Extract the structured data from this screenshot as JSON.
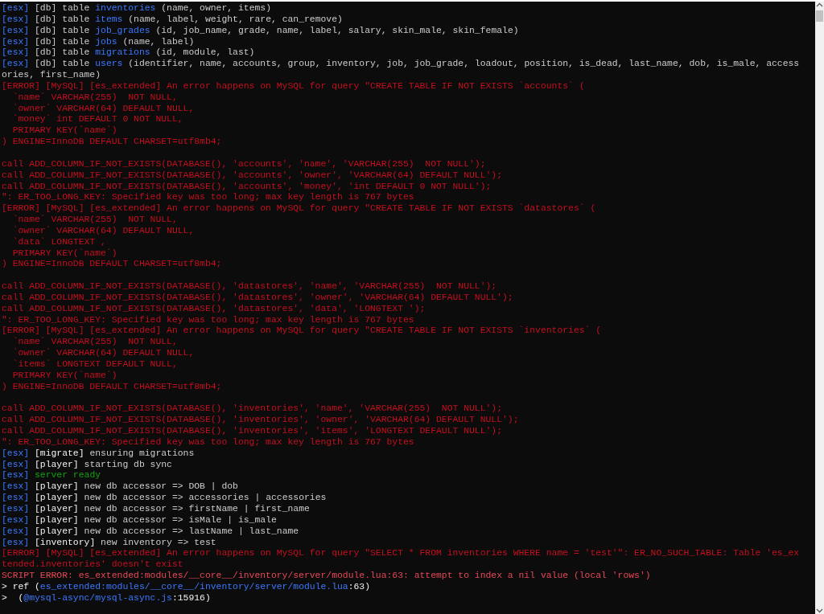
{
  "console": {
    "lines": [
      {
        "kind": "text",
        "segments": [
          {
            "kind": "tag",
            "text": "[esx]"
          },
          {
            "kind": "text",
            "text": " [db] table "
          },
          {
            "kind": "name",
            "text": "inventories"
          },
          {
            "kind": "text",
            "text": " (name, owner, items)"
          }
        ]
      },
      {
        "kind": "text",
        "segments": [
          {
            "kind": "tag",
            "text": "[esx]"
          },
          {
            "kind": "text",
            "text": " [db] table "
          },
          {
            "kind": "name",
            "text": "items"
          },
          {
            "kind": "text",
            "text": " (name, label, weight, rare, can_remove)"
          }
        ]
      },
      {
        "kind": "text",
        "segments": [
          {
            "kind": "tag",
            "text": "[esx]"
          },
          {
            "kind": "text",
            "text": " [db] table "
          },
          {
            "kind": "name",
            "text": "job_grades"
          },
          {
            "kind": "text",
            "text": " (id, job_name, grade, name, label, salary, skin_male, skin_female)"
          }
        ]
      },
      {
        "kind": "text",
        "segments": [
          {
            "kind": "tag",
            "text": "[esx]"
          },
          {
            "kind": "text",
            "text": " [db] table "
          },
          {
            "kind": "name",
            "text": "jobs"
          },
          {
            "kind": "text",
            "text": " (name, label)"
          }
        ]
      },
      {
        "kind": "text",
        "segments": [
          {
            "kind": "tag",
            "text": "[esx]"
          },
          {
            "kind": "text",
            "text": " [db] table "
          },
          {
            "kind": "name",
            "text": "migrations"
          },
          {
            "kind": "text",
            "text": " (id, module, last)"
          }
        ]
      },
      {
        "kind": "text",
        "segments": [
          {
            "kind": "tag",
            "text": "[esx]"
          },
          {
            "kind": "text",
            "text": " [db] table "
          },
          {
            "kind": "name",
            "text": "users"
          },
          {
            "kind": "text",
            "text": " (identifier, name, accounts, group, inventory, job, job_grade, loadout, position, is_dead, last_name, dob, is_male, access"
          }
        ]
      },
      {
        "kind": "text",
        "segments": [
          {
            "kind": "text",
            "text": "ories, first_name)"
          }
        ]
      },
      {
        "kind": "text",
        "segments": [
          {
            "kind": "error",
            "text": "[ERROR] [MySQL] [es_extended] An error happens on MySQL for query \"CREATE TABLE IF NOT EXISTS `accounts` ("
          }
        ]
      },
      {
        "kind": "text",
        "segments": [
          {
            "kind": "error",
            "text": "  `name` VARCHAR(255)  NOT NULL,"
          }
        ]
      },
      {
        "kind": "text",
        "segments": [
          {
            "kind": "error",
            "text": "  `owner` VARCHAR(64) DEFAULT NULL,"
          }
        ]
      },
      {
        "kind": "text",
        "segments": [
          {
            "kind": "error",
            "text": "  `money` int DEFAULT 0 NOT NULL,"
          }
        ]
      },
      {
        "kind": "text",
        "segments": [
          {
            "kind": "error",
            "text": "  PRIMARY KEY(`name`)"
          }
        ]
      },
      {
        "kind": "text",
        "segments": [
          {
            "kind": "error",
            "text": ") ENGINE=InnoDB DEFAULT CHARSET=utf8mb4;"
          }
        ]
      },
      {
        "kind": "blank"
      },
      {
        "kind": "text",
        "segments": [
          {
            "kind": "error",
            "text": "call ADD_COLUMN_IF_NOT_EXISTS(DATABASE(), 'accounts', 'name', 'VARCHAR(255)  NOT NULL');"
          }
        ]
      },
      {
        "kind": "text",
        "segments": [
          {
            "kind": "error",
            "text": "call ADD_COLUMN_IF_NOT_EXISTS(DATABASE(), 'accounts', 'owner', 'VARCHAR(64) DEFAULT NULL');"
          }
        ]
      },
      {
        "kind": "text",
        "segments": [
          {
            "kind": "error",
            "text": "call ADD_COLUMN_IF_NOT_EXISTS(DATABASE(), 'accounts', 'money', 'int DEFAULT 0 NOT NULL');"
          }
        ]
      },
      {
        "kind": "text",
        "segments": [
          {
            "kind": "error",
            "text": "\": ER_TOO_LONG_KEY: Specified key was too long; max key length is 767 bytes"
          }
        ]
      },
      {
        "kind": "text",
        "segments": [
          {
            "kind": "error",
            "text": "[ERROR] [MySQL] [es_extended] An error happens on MySQL for query \"CREATE TABLE IF NOT EXISTS `datastores` ("
          }
        ]
      },
      {
        "kind": "text",
        "segments": [
          {
            "kind": "error",
            "text": "  `name` VARCHAR(255)  NOT NULL,"
          }
        ]
      },
      {
        "kind": "text",
        "segments": [
          {
            "kind": "error",
            "text": "  `owner` VARCHAR(64) DEFAULT NULL,"
          }
        ]
      },
      {
        "kind": "text",
        "segments": [
          {
            "kind": "error",
            "text": "  `data` LONGTEXT ,"
          }
        ]
      },
      {
        "kind": "text",
        "segments": [
          {
            "kind": "error",
            "text": "  PRIMARY KEY(`name`)"
          }
        ]
      },
      {
        "kind": "text",
        "segments": [
          {
            "kind": "error",
            "text": ") ENGINE=InnoDB DEFAULT CHARSET=utf8mb4;"
          }
        ]
      },
      {
        "kind": "blank"
      },
      {
        "kind": "text",
        "segments": [
          {
            "kind": "error",
            "text": "call ADD_COLUMN_IF_NOT_EXISTS(DATABASE(), 'datastores', 'name', 'VARCHAR(255)  NOT NULL');"
          }
        ]
      },
      {
        "kind": "text",
        "segments": [
          {
            "kind": "error",
            "text": "call ADD_COLUMN_IF_NOT_EXISTS(DATABASE(), 'datastores', 'owner', 'VARCHAR(64) DEFAULT NULL');"
          }
        ]
      },
      {
        "kind": "text",
        "segments": [
          {
            "kind": "error",
            "text": "call ADD_COLUMN_IF_NOT_EXISTS(DATABASE(), 'datastores', 'data', 'LONGTEXT ');"
          }
        ]
      },
      {
        "kind": "text",
        "segments": [
          {
            "kind": "error",
            "text": "\": ER_TOO_LONG_KEY: Specified key was too long; max key length is 767 bytes"
          }
        ]
      },
      {
        "kind": "text",
        "segments": [
          {
            "kind": "error",
            "text": "[ERROR] [MySQL] [es_extended] An error happens on MySQL for query \"CREATE TABLE IF NOT EXISTS `inventories` ("
          }
        ]
      },
      {
        "kind": "text",
        "segments": [
          {
            "kind": "error",
            "text": "  `name` VARCHAR(255)  NOT NULL,"
          }
        ]
      },
      {
        "kind": "text",
        "segments": [
          {
            "kind": "error",
            "text": "  `owner` VARCHAR(64) DEFAULT NULL,"
          }
        ]
      },
      {
        "kind": "text",
        "segments": [
          {
            "kind": "error",
            "text": "  `items` LONGTEXT DEFAULT NULL,"
          }
        ]
      },
      {
        "kind": "text",
        "segments": [
          {
            "kind": "error",
            "text": "  PRIMARY KEY(`name`)"
          }
        ]
      },
      {
        "kind": "text",
        "segments": [
          {
            "kind": "error",
            "text": ") ENGINE=InnoDB DEFAULT CHARSET=utf8mb4;"
          }
        ]
      },
      {
        "kind": "blank"
      },
      {
        "kind": "text",
        "segments": [
          {
            "kind": "error",
            "text": "call ADD_COLUMN_IF_NOT_EXISTS(DATABASE(), 'inventories', 'name', 'VARCHAR(255)  NOT NULL');"
          }
        ]
      },
      {
        "kind": "text",
        "segments": [
          {
            "kind": "error",
            "text": "call ADD_COLUMN_IF_NOT_EXISTS(DATABASE(), 'inventories', 'owner', 'VARCHAR(64) DEFAULT NULL');"
          }
        ]
      },
      {
        "kind": "text",
        "segments": [
          {
            "kind": "error",
            "text": "call ADD_COLUMN_IF_NOT_EXISTS(DATABASE(), 'inventories', 'items', 'LONGTEXT DEFAULT NULL');"
          }
        ]
      },
      {
        "kind": "text",
        "segments": [
          {
            "kind": "error",
            "text": "\": ER_TOO_LONG_KEY: Specified key was too long; max key length is 767 bytes"
          }
        ]
      },
      {
        "kind": "text",
        "segments": [
          {
            "kind": "tag",
            "text": "[esx]"
          },
          {
            "kind": "bright",
            "text": " [migrate]"
          },
          {
            "kind": "text",
            "text": " ensuring migrations"
          }
        ]
      },
      {
        "kind": "text",
        "segments": [
          {
            "kind": "tag",
            "text": "[esx]"
          },
          {
            "kind": "bright",
            "text": " [player]"
          },
          {
            "kind": "text",
            "text": " starting db sync"
          }
        ]
      },
      {
        "kind": "text",
        "segments": [
          {
            "kind": "tag",
            "text": "[esx]"
          },
          {
            "kind": "ok",
            "text": " server ready"
          }
        ]
      },
      {
        "kind": "text",
        "segments": [
          {
            "kind": "tag",
            "text": "[esx]"
          },
          {
            "kind": "bright",
            "text": " [player]"
          },
          {
            "kind": "text",
            "text": " new db accessor => DOB | dob"
          }
        ]
      },
      {
        "kind": "text",
        "segments": [
          {
            "kind": "tag",
            "text": "[esx]"
          },
          {
            "kind": "bright",
            "text": " [player]"
          },
          {
            "kind": "text",
            "text": " new db accessor => accessories | accessories"
          }
        ]
      },
      {
        "kind": "text",
        "segments": [
          {
            "kind": "tag",
            "text": "[esx]"
          },
          {
            "kind": "bright",
            "text": " [player]"
          },
          {
            "kind": "text",
            "text": " new db accessor => firstName | first_name"
          }
        ]
      },
      {
        "kind": "text",
        "segments": [
          {
            "kind": "tag",
            "text": "[esx]"
          },
          {
            "kind": "bright",
            "text": " [player]"
          },
          {
            "kind": "text",
            "text": " new db accessor => isMale | is_male"
          }
        ]
      },
      {
        "kind": "text",
        "segments": [
          {
            "kind": "tag",
            "text": "[esx]"
          },
          {
            "kind": "bright",
            "text": " [player]"
          },
          {
            "kind": "text",
            "text": " new db accessor => lastName | last_name"
          }
        ]
      },
      {
        "kind": "text",
        "segments": [
          {
            "kind": "tag",
            "text": "[esx]"
          },
          {
            "kind": "bright",
            "text": " [inventory]"
          },
          {
            "kind": "text",
            "text": " new inventory => test"
          }
        ]
      },
      {
        "kind": "text",
        "segments": [
          {
            "kind": "error",
            "text": "[ERROR] [MySQL] [es_extended] An error happens on MySQL for query \"SELECT * FROM inventories WHERE name = 'test'\": ER_NO_SUCH_TABLE: Table 'es_ex"
          }
        ]
      },
      {
        "kind": "text",
        "segments": [
          {
            "kind": "error",
            "text": "tended.inventories' doesn't exist"
          }
        ]
      },
      {
        "kind": "text",
        "segments": [
          {
            "kind": "fault",
            "text": "SCRIPT ERROR: es_extended:modules/__core__/inventory/server/module.lua:63: attempt to index a nil value (local 'rows')"
          }
        ]
      },
      {
        "kind": "text",
        "segments": [
          {
            "kind": "bright",
            "text": "> ref ("
          },
          {
            "kind": "name",
            "text": "es_extended:modules/__core__/inventory/server/module.lua"
          },
          {
            "kind": "bright",
            "text": ":63)"
          }
        ]
      },
      {
        "kind": "text",
        "segments": [
          {
            "kind": "bright",
            "text": ">  ("
          },
          {
            "kind": "name",
            "text": "@mysql-async/mysql-async.js"
          },
          {
            "kind": "bright",
            "text": ":15916)"
          }
        ]
      }
    ]
  }
}
